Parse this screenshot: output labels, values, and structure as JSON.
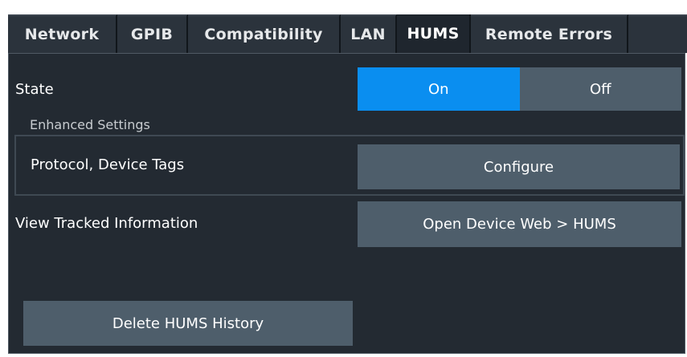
{
  "tabs": [
    {
      "label": "Network",
      "active": false
    },
    {
      "label": "GPIB",
      "active": false
    },
    {
      "label": "Compatibility",
      "active": false
    },
    {
      "label": "LAN",
      "active": false
    },
    {
      "label": "HUMS",
      "active": true
    },
    {
      "label": "Remote Errors",
      "active": false
    }
  ],
  "state": {
    "label": "State",
    "on_label": "On",
    "off_label": "Off",
    "selected": "On"
  },
  "enhanced": {
    "caption": "Enhanced Settings",
    "protocol_label": "Protocol, Device Tags",
    "configure_label": "Configure"
  },
  "tracked": {
    "label": "View Tracked Information",
    "button_label": "Open Device Web > HUMS"
  },
  "history": {
    "delete_label": "Delete HUMS History"
  },
  "colors": {
    "accent_on": "#0a8ef0",
    "button": "#4e5e6b",
    "panel": "#232a32"
  }
}
